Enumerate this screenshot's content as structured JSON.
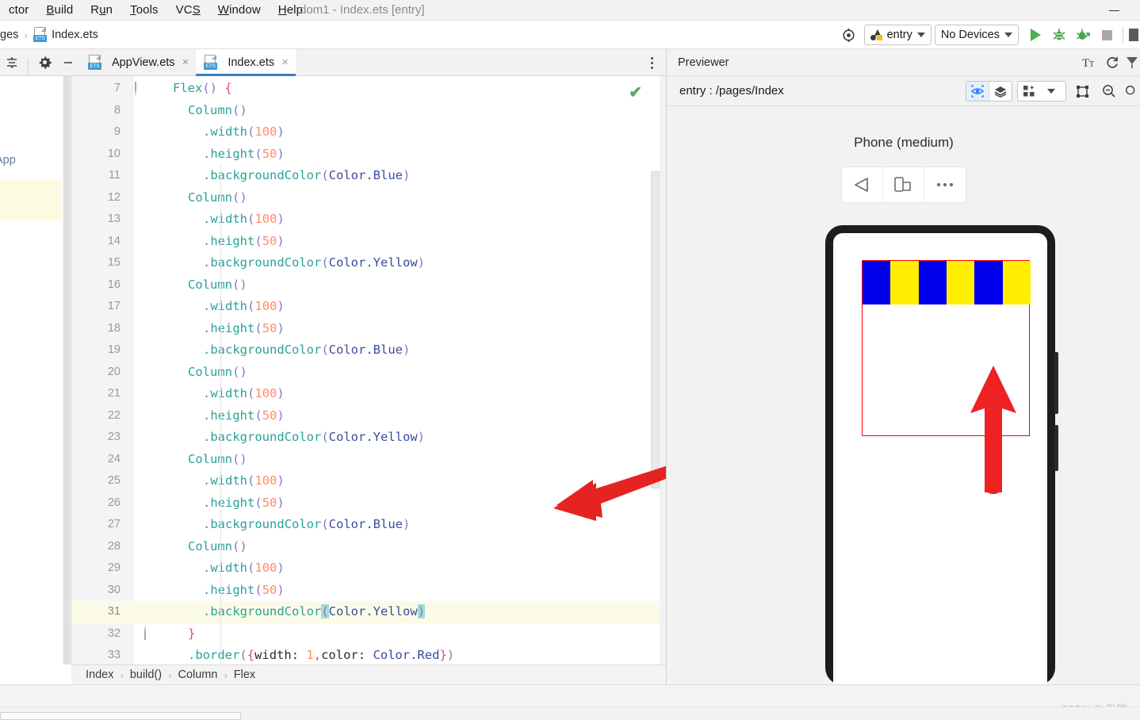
{
  "menubar": {
    "items": [
      {
        "label": "ctor",
        "mnemonic": ""
      },
      {
        "label": "Build",
        "mnemonic": "B"
      },
      {
        "label": "Run",
        "mnemonic": "u"
      },
      {
        "label": "Tools",
        "mnemonic": "T"
      },
      {
        "label": "VCS",
        "mnemonic": "S"
      },
      {
        "label": "Window",
        "mnemonic": "W"
      },
      {
        "label": "Help",
        "mnemonic": "H"
      }
    ],
    "window_title": "dom1 - Index.ets [entry]",
    "minimize_label": "—"
  },
  "breadcrumb_top": {
    "segment1": "ges",
    "separator": "›",
    "file": "Index.ets",
    "file_icon": "ets-file-icon"
  },
  "run_toolbar": {
    "target_icon": "target-icon",
    "module": "entry",
    "device": "No Devices",
    "run_icon": "run-play-icon",
    "debug_icon": "debug-bug-icon",
    "attach_icon": "attach-debugger-icon",
    "stop_icon": "stop-icon",
    "more_icon": "more-icon"
  },
  "editor_tabs": {
    "collapse_icon": "collapse-all-icon",
    "settings_icon": "gear-icon",
    "minimize_icon": "minimize-icon",
    "kebab_icon": "more-vertical-icon",
    "tabs": [
      {
        "label": "AppView.ets",
        "active": false,
        "close": "×"
      },
      {
        "label": "Index.ets",
        "active": true,
        "close": "×"
      }
    ]
  },
  "left_panel": {
    "visible_label": "App"
  },
  "editor": {
    "status_icon": "inspection-ok-check",
    "first_line": 7,
    "lines": [
      {
        "n": 7,
        "indent": 0,
        "tokens": [
          {
            "t": "Flex",
            "c": "t-fn"
          },
          {
            "t": "()",
            "c": "t-par"
          },
          {
            "t": " ",
            "c": "t-plain"
          },
          {
            "t": "{",
            "c": "t-brace"
          }
        ]
      },
      {
        "n": 8,
        "indent": 1,
        "tokens": [
          {
            "t": "Column",
            "c": "t-fn"
          },
          {
            "t": "()",
            "c": "t-par"
          }
        ]
      },
      {
        "n": 9,
        "indent": 2,
        "tokens": [
          {
            "t": ".",
            "c": "t-dot"
          },
          {
            "t": "width",
            "c": "t-fn"
          },
          {
            "t": "(",
            "c": "t-par"
          },
          {
            "t": "100",
            "c": "t-num"
          },
          {
            "t": ")",
            "c": "t-par"
          }
        ]
      },
      {
        "n": 10,
        "indent": 2,
        "tokens": [
          {
            "t": ".",
            "c": "t-dot"
          },
          {
            "t": "height",
            "c": "t-fn"
          },
          {
            "t": "(",
            "c": "t-par"
          },
          {
            "t": "50",
            "c": "t-num"
          },
          {
            "t": ")",
            "c": "t-par"
          }
        ]
      },
      {
        "n": 11,
        "indent": 2,
        "tokens": [
          {
            "t": ".",
            "c": "t-dot"
          },
          {
            "t": "backgroundColor",
            "c": "t-fn"
          },
          {
            "t": "(",
            "c": "t-par"
          },
          {
            "t": "Color.Blue",
            "c": "t-enum"
          },
          {
            "t": ")",
            "c": "t-par"
          }
        ]
      },
      {
        "n": 12,
        "indent": 1,
        "tokens": [
          {
            "t": "Column",
            "c": "t-fn"
          },
          {
            "t": "()",
            "c": "t-par"
          }
        ]
      },
      {
        "n": 13,
        "indent": 2,
        "tokens": [
          {
            "t": ".",
            "c": "t-dot"
          },
          {
            "t": "width",
            "c": "t-fn"
          },
          {
            "t": "(",
            "c": "t-par"
          },
          {
            "t": "100",
            "c": "t-num"
          },
          {
            "t": ")",
            "c": "t-par"
          }
        ]
      },
      {
        "n": 14,
        "indent": 2,
        "tokens": [
          {
            "t": ".",
            "c": "t-dot"
          },
          {
            "t": "height",
            "c": "t-fn"
          },
          {
            "t": "(",
            "c": "t-par"
          },
          {
            "t": "50",
            "c": "t-num"
          },
          {
            "t": ")",
            "c": "t-par"
          }
        ]
      },
      {
        "n": 15,
        "indent": 2,
        "tokens": [
          {
            "t": ".",
            "c": "t-dot"
          },
          {
            "t": "backgroundColor",
            "c": "t-fn"
          },
          {
            "t": "(",
            "c": "t-par"
          },
          {
            "t": "Color.Yellow",
            "c": "t-enum"
          },
          {
            "t": ")",
            "c": "t-par"
          }
        ]
      },
      {
        "n": 16,
        "indent": 1,
        "tokens": [
          {
            "t": "Column",
            "c": "t-fn"
          },
          {
            "t": "()",
            "c": "t-par"
          }
        ]
      },
      {
        "n": 17,
        "indent": 2,
        "tokens": [
          {
            "t": ".",
            "c": "t-dot"
          },
          {
            "t": "width",
            "c": "t-fn"
          },
          {
            "t": "(",
            "c": "t-par"
          },
          {
            "t": "100",
            "c": "t-num"
          },
          {
            "t": ")",
            "c": "t-par"
          }
        ]
      },
      {
        "n": 18,
        "indent": 2,
        "tokens": [
          {
            "t": ".",
            "c": "t-dot"
          },
          {
            "t": "height",
            "c": "t-fn"
          },
          {
            "t": "(",
            "c": "t-par"
          },
          {
            "t": "50",
            "c": "t-num"
          },
          {
            "t": ")",
            "c": "t-par"
          }
        ]
      },
      {
        "n": 19,
        "indent": 2,
        "tokens": [
          {
            "t": ".",
            "c": "t-dot"
          },
          {
            "t": "backgroundColor",
            "c": "t-fn"
          },
          {
            "t": "(",
            "c": "t-par"
          },
          {
            "t": "Color.Blue",
            "c": "t-enum"
          },
          {
            "t": ")",
            "c": "t-par"
          }
        ]
      },
      {
        "n": 20,
        "indent": 1,
        "tokens": [
          {
            "t": "Column",
            "c": "t-fn"
          },
          {
            "t": "()",
            "c": "t-par"
          }
        ]
      },
      {
        "n": 21,
        "indent": 2,
        "tokens": [
          {
            "t": ".",
            "c": "t-dot"
          },
          {
            "t": "width",
            "c": "t-fn"
          },
          {
            "t": "(",
            "c": "t-par"
          },
          {
            "t": "100",
            "c": "t-num"
          },
          {
            "t": ")",
            "c": "t-par"
          }
        ]
      },
      {
        "n": 22,
        "indent": 2,
        "tokens": [
          {
            "t": ".",
            "c": "t-dot"
          },
          {
            "t": "height",
            "c": "t-fn"
          },
          {
            "t": "(",
            "c": "t-par"
          },
          {
            "t": "50",
            "c": "t-num"
          },
          {
            "t": ")",
            "c": "t-par"
          }
        ]
      },
      {
        "n": 23,
        "indent": 2,
        "tokens": [
          {
            "t": ".",
            "c": "t-dot"
          },
          {
            "t": "backgroundColor",
            "c": "t-fn"
          },
          {
            "t": "(",
            "c": "t-par"
          },
          {
            "t": "Color.Yellow",
            "c": "t-enum"
          },
          {
            "t": ")",
            "c": "t-par"
          }
        ]
      },
      {
        "n": 24,
        "indent": 1,
        "tokens": [
          {
            "t": "Column",
            "c": "t-fn"
          },
          {
            "t": "()",
            "c": "t-par"
          }
        ]
      },
      {
        "n": 25,
        "indent": 2,
        "tokens": [
          {
            "t": ".",
            "c": "t-dot"
          },
          {
            "t": "width",
            "c": "t-fn"
          },
          {
            "t": "(",
            "c": "t-par"
          },
          {
            "t": "100",
            "c": "t-num"
          },
          {
            "t": ")",
            "c": "t-par"
          }
        ]
      },
      {
        "n": 26,
        "indent": 2,
        "tokens": [
          {
            "t": ".",
            "c": "t-dot"
          },
          {
            "t": "height",
            "c": "t-fn"
          },
          {
            "t": "(",
            "c": "t-par"
          },
          {
            "t": "50",
            "c": "t-num"
          },
          {
            "t": ")",
            "c": "t-par"
          }
        ]
      },
      {
        "n": 27,
        "indent": 2,
        "tokens": [
          {
            "t": ".",
            "c": "t-dot"
          },
          {
            "t": "backgroundColor",
            "c": "t-fn"
          },
          {
            "t": "(",
            "c": "t-par"
          },
          {
            "t": "Color.Blue",
            "c": "t-enum"
          },
          {
            "t": ")",
            "c": "t-par"
          }
        ]
      },
      {
        "n": 28,
        "indent": 1,
        "tokens": [
          {
            "t": "Column",
            "c": "t-fn"
          },
          {
            "t": "()",
            "c": "t-par"
          }
        ]
      },
      {
        "n": 29,
        "indent": 2,
        "tokens": [
          {
            "t": ".",
            "c": "t-dot"
          },
          {
            "t": "width",
            "c": "t-fn"
          },
          {
            "t": "(",
            "c": "t-par"
          },
          {
            "t": "100",
            "c": "t-num"
          },
          {
            "t": ")",
            "c": "t-par"
          }
        ]
      },
      {
        "n": 30,
        "indent": 2,
        "tokens": [
          {
            "t": ".",
            "c": "t-dot"
          },
          {
            "t": "height",
            "c": "t-fn"
          },
          {
            "t": "(",
            "c": "t-par"
          },
          {
            "t": "50",
            "c": "t-num"
          },
          {
            "t": ")",
            "c": "t-par"
          }
        ]
      },
      {
        "n": 31,
        "indent": 2,
        "highlight": true,
        "tokens": [
          {
            "t": ".",
            "c": "t-dot"
          },
          {
            "t": "backgroundColor",
            "c": "t-fn"
          },
          {
            "t": "(",
            "c": "t-par sel"
          },
          {
            "t": "Color.Yellow",
            "c": "t-enum"
          },
          {
            "t": ")",
            "c": "t-par sel"
          }
        ]
      },
      {
        "n": 32,
        "indent": 1,
        "tokens": [
          {
            "t": "}",
            "c": "t-brace"
          }
        ]
      },
      {
        "n": 33,
        "indent": 1,
        "tokens": [
          {
            "t": ".",
            "c": "t-dot"
          },
          {
            "t": "border",
            "c": "t-fn"
          },
          {
            "t": "(",
            "c": "t-par"
          },
          {
            "t": "{",
            "c": "t-brace"
          },
          {
            "t": "width",
            "c": "t-plain"
          },
          {
            "t": ":",
            "c": "t-plain"
          },
          {
            "t": " ",
            "c": "t-plain"
          },
          {
            "t": "1",
            "c": "t-num"
          },
          {
            "t": ",",
            "c": "t-brace"
          },
          {
            "t": "color",
            "c": "t-plain"
          },
          {
            "t": ":",
            "c": "t-plain"
          },
          {
            "t": " ",
            "c": "t-plain"
          },
          {
            "t": "Color.Red",
            "c": "t-enum"
          },
          {
            "t": "}",
            "c": "t-brace"
          },
          {
            "t": ")",
            "c": "t-par"
          }
        ]
      }
    ],
    "annotation_arrow": "red-arrow-pointing-left"
  },
  "editor_breadcrumb": {
    "items": [
      "Index",
      "build()",
      "Column",
      "Flex"
    ],
    "separator": "›"
  },
  "previewer": {
    "title": "Previewer",
    "head_icons": [
      "font-size-icon",
      "refresh-icon",
      "inspector-icon"
    ],
    "path": "entry : /pages/Index",
    "inspect_icon": "inspect-eye-icon",
    "layers_icon": "layers-icon",
    "grid_icon": "multi-device-grid-icon",
    "grid_caret": "chevron-down-icon",
    "frame_icon": "frame-icon",
    "zoom_out_icon": "zoom-out-icon",
    "zoom_in_icon": "zoom-in-icon",
    "device_name": "Phone (medium)",
    "controls": [
      "rotate-left-icon",
      "orientation-icon",
      "more-dots-icon"
    ],
    "render": {
      "border_color": "#ff0000",
      "columns": [
        {
          "color": "#0000ee",
          "name": "Blue"
        },
        {
          "color": "#ffee00",
          "name": "Yellow"
        },
        {
          "color": "#0000ee",
          "name": "Blue"
        },
        {
          "color": "#ffee00",
          "name": "Yellow"
        },
        {
          "color": "#0000ee",
          "name": "Blue"
        },
        {
          "color": "#ffee00",
          "name": "Yellow"
        }
      ],
      "annotation_arrow": "red-arrow-pointing-up"
    }
  },
  "watermark": "CSDN @-耿瑞-",
  "colors": {
    "accent": "#3c7cc4",
    "run_green": "#4caf50",
    "annotation_red": "#e52421",
    "blue_swatch": "#0000ee",
    "yellow_swatch": "#ffee00"
  }
}
